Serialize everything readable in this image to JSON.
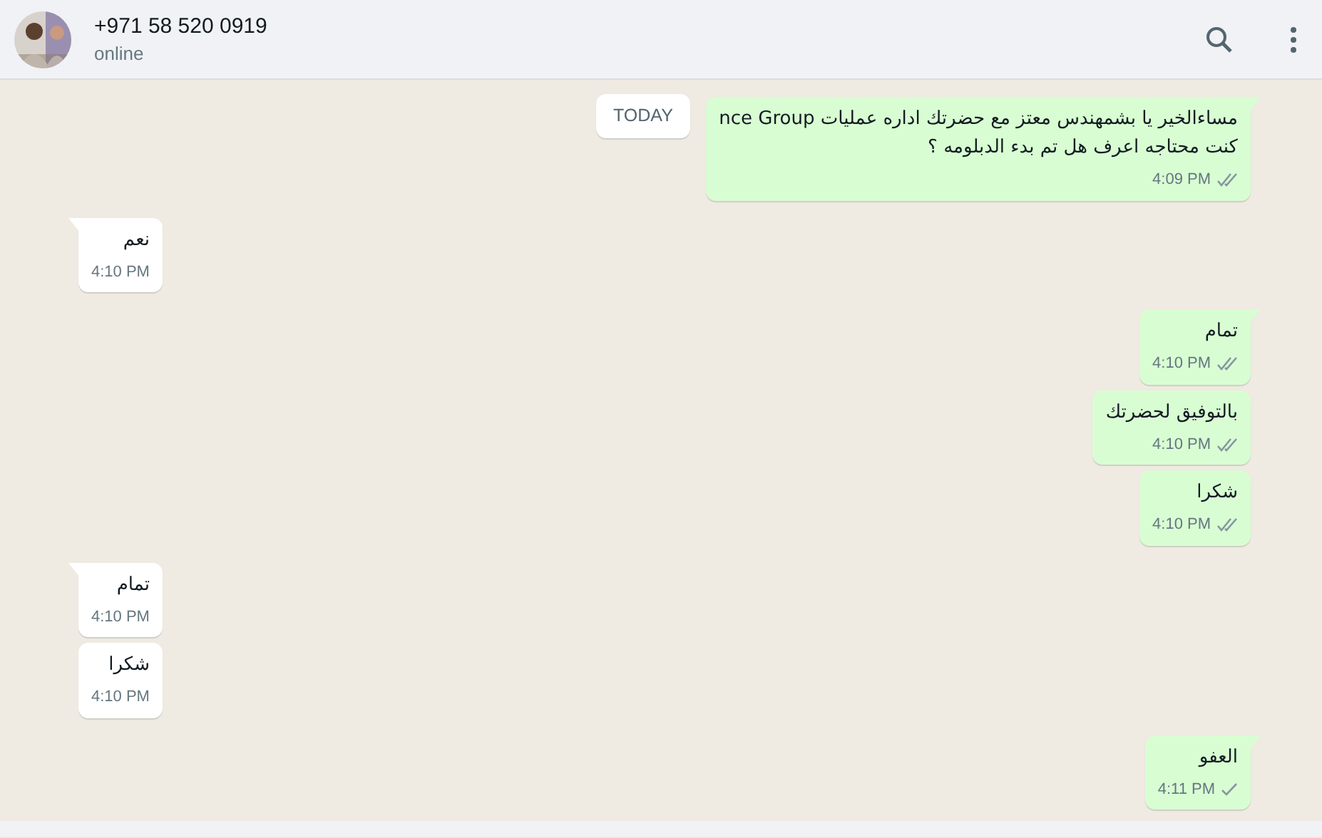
{
  "header": {
    "contact": "+971 58 520 0919",
    "status": "online"
  },
  "date_badge": "TODAY",
  "messages": [
    {
      "outgoing": true,
      "tail": true,
      "lines": [
        "مساءالخير يا بشمهندس معتز مع حضرتك اداره عمليات nce Group",
        "كنت محتاجه اعرف هل تم بدء الدبلومه ؟"
      ],
      "time": "4:09 PM",
      "read": true
    },
    {
      "outgoing": false,
      "tail": true,
      "lines": [
        "نعم"
      ],
      "time": "4:10 PM"
    },
    {
      "outgoing": true,
      "tail": true,
      "lines": [
        "تمام"
      ],
      "time": "4:10 PM",
      "read": true
    },
    {
      "outgoing": true,
      "tail": false,
      "lines": [
        "بالتوفيق لحضرتك"
      ],
      "time": "4:10 PM",
      "read": true
    },
    {
      "outgoing": true,
      "tail": false,
      "lines": [
        "شكرا"
      ],
      "time": "4:10 PM",
      "read": true
    },
    {
      "outgoing": false,
      "tail": true,
      "lines": [
        "تمام"
      ],
      "time": "4:10 PM"
    },
    {
      "outgoing": false,
      "tail": false,
      "lines": [
        "شكرا"
      ],
      "time": "4:10 PM"
    },
    {
      "outgoing": true,
      "tail": true,
      "lines": [
        "العفو"
      ],
      "time": "4:11 PM",
      "read": false
    }
  ]
}
